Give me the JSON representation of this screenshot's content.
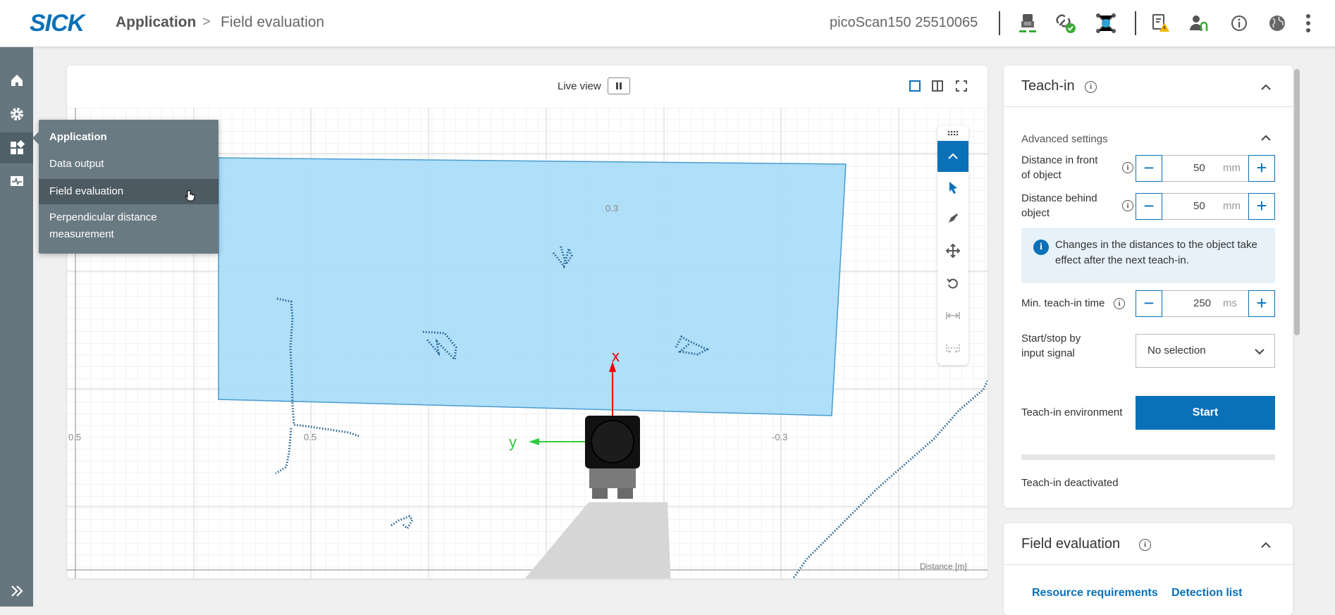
{
  "header": {
    "logo": "SICK",
    "breadcrumb": {
      "app": "Application",
      "separator": ">",
      "page": "Field evaluation"
    },
    "device": "picoScan150 25510065"
  },
  "flyout": {
    "title": "Application",
    "items": [
      "Data output",
      "Field evaluation",
      "Perpendicular distance measurement"
    ]
  },
  "viewer": {
    "live_view_label": "Live view",
    "axis": {
      "x_label": "x",
      "y_label": "y",
      "tick_top": "0.3",
      "tick_left": "0.5",
      "tick_left2": "0.5",
      "tick_right": "-0.3",
      "distance_label": "Distance [m]"
    }
  },
  "teach_in": {
    "title": "Teach-in",
    "advanced_label": "Advanced settings",
    "distance_front": {
      "label": "Distance in front of object",
      "value": "50",
      "unit": "mm"
    },
    "distance_behind": {
      "label": "Distance behind object",
      "value": "50",
      "unit": "mm"
    },
    "note": "Changes in the distances to the object take effect after the next teach-in.",
    "min_time": {
      "label": "Min. teach-in time",
      "value": "250",
      "unit": "ms"
    },
    "start_stop": {
      "label": "Start/stop by input signal",
      "value": "No selection"
    },
    "environment": {
      "label": "Teach-in environment",
      "button": "Start"
    },
    "status": "Teach-in deactivated"
  },
  "field_evaluation": {
    "title": "Field evaluation",
    "tabs": [
      "Resource requirements",
      "Detection list"
    ]
  },
  "colors": {
    "brand": "#0a70b8",
    "rail": "#67767e",
    "field_fill": "#a6dcf8",
    "points": "#1f5f8b"
  }
}
